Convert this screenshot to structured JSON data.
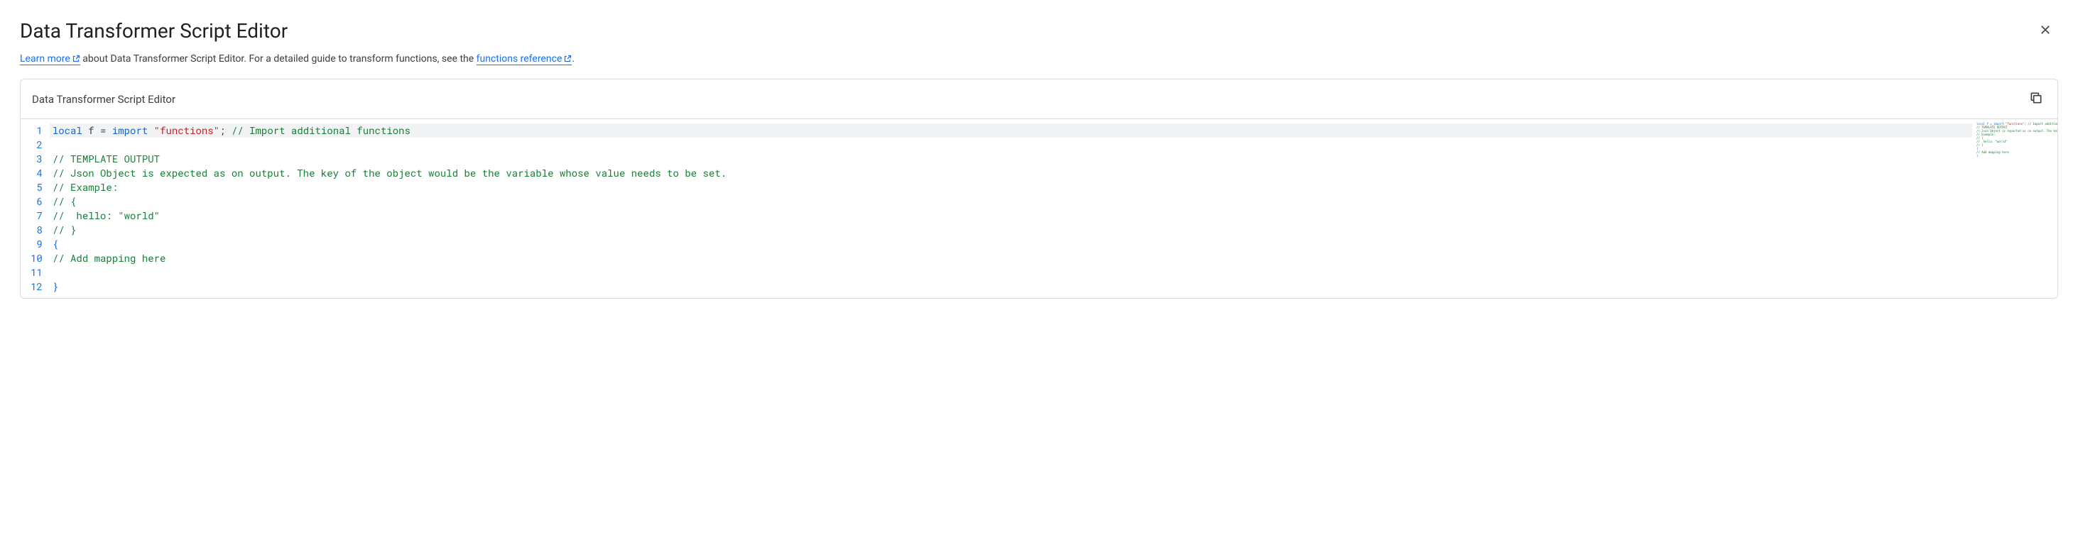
{
  "header": {
    "title": "Data Transformer Script Editor"
  },
  "subtitle": {
    "learn_more": "Learn more",
    "mid_text": " about Data Transformer Script Editor. For a detailed guide to transform functions, see the ",
    "functions_ref": "functions reference",
    "end": "."
  },
  "panel": {
    "title": "Data Transformer Script Editor"
  },
  "code": {
    "lines": [
      {
        "n": 1,
        "tokens": [
          {
            "cls": "tok-kw",
            "t": "local"
          },
          {
            "cls": "tok-plain",
            "t": " f = "
          },
          {
            "cls": "tok-kw",
            "t": "import"
          },
          {
            "cls": "tok-plain",
            "t": " "
          },
          {
            "cls": "tok-str",
            "t": "\"functions\""
          },
          {
            "cls": "tok-plain",
            "t": "; "
          },
          {
            "cls": "tok-comment",
            "t": "// Import additional functions"
          }
        ],
        "active": true
      },
      {
        "n": 2,
        "tokens": []
      },
      {
        "n": 3,
        "tokens": [
          {
            "cls": "tok-comment",
            "t": "// TEMPLATE OUTPUT"
          }
        ]
      },
      {
        "n": 4,
        "tokens": [
          {
            "cls": "tok-comment",
            "t": "// Json Object is expected as on output. The key of the object would be the variable whose value needs to be set."
          }
        ]
      },
      {
        "n": 5,
        "tokens": [
          {
            "cls": "tok-comment",
            "t": "// Example:"
          }
        ]
      },
      {
        "n": 6,
        "tokens": [
          {
            "cls": "tok-comment",
            "t": "// {"
          }
        ]
      },
      {
        "n": 7,
        "tokens": [
          {
            "cls": "tok-comment",
            "t": "//  hello: \"world\""
          }
        ]
      },
      {
        "n": 8,
        "tokens": [
          {
            "cls": "tok-comment",
            "t": "// }"
          }
        ]
      },
      {
        "n": 9,
        "tokens": [
          {
            "cls": "tok-punct",
            "t": "{"
          }
        ]
      },
      {
        "n": 10,
        "tokens": [
          {
            "cls": "tok-comment",
            "t": "// Add mapping here"
          }
        ]
      },
      {
        "n": 11,
        "tokens": []
      },
      {
        "n": 12,
        "tokens": [
          {
            "cls": "tok-punct",
            "t": "}"
          }
        ]
      }
    ]
  }
}
